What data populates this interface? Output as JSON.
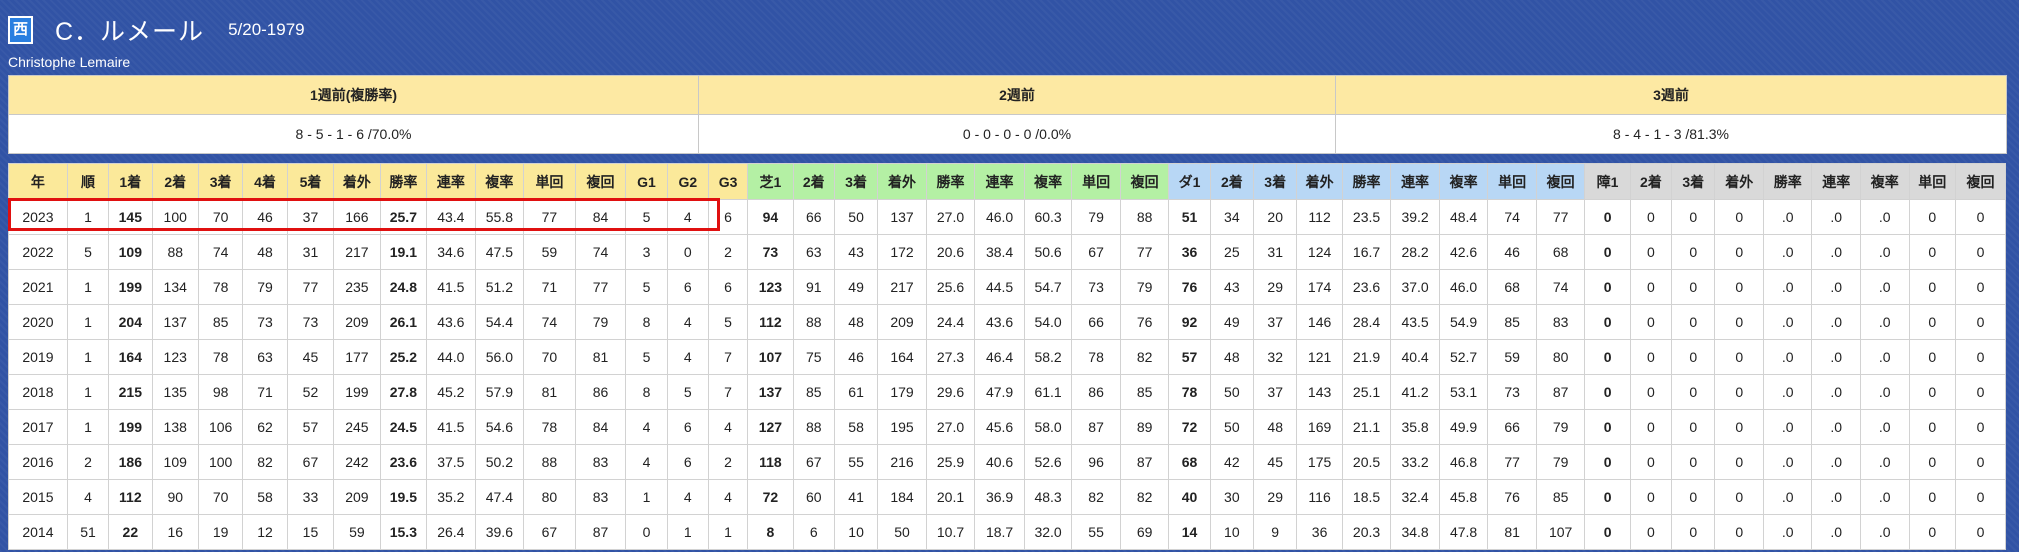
{
  "jockey": {
    "badge": "西",
    "name_jp": "C．ルメール",
    "dob": "5/20-1979",
    "name_en": "Christophe Lemaire"
  },
  "weeks": {
    "headers": [
      "1週前(複勝率)",
      "2週前",
      "3週前"
    ],
    "values": [
      "8 - 5 - 1 - 6 /70.0%",
      "0 - 0 - 0 - 0 /0.0%",
      "8 - 4 - 1 - 3 /81.3%"
    ]
  },
  "table": {
    "headers": [
      "年",
      "順",
      "1着",
      "2着",
      "3着",
      "4着",
      "5着",
      "着外",
      "勝率",
      "連率",
      "複率",
      "単回",
      "複回",
      "G1",
      "G2",
      "G3",
      "芝1",
      "2着",
      "3着",
      "着外",
      "勝率",
      "連率",
      "複率",
      "単回",
      "複回",
      "ダ1",
      "2着",
      "3着",
      "着外",
      "勝率",
      "連率",
      "複率",
      "単回",
      "複回",
      "障1",
      "2着",
      "3着",
      "着外",
      "勝率",
      "連率",
      "複率",
      "単回",
      "複回"
    ],
    "rows": [
      [
        "2023",
        "1",
        "145",
        "100",
        "70",
        "46",
        "37",
        "166",
        "25.7",
        "43.4",
        "55.8",
        "77",
        "84",
        "5",
        "4",
        "6",
        "94",
        "66",
        "50",
        "137",
        "27.0",
        "46.0",
        "60.3",
        "79",
        "88",
        "51",
        "34",
        "20",
        "112",
        "23.5",
        "39.2",
        "48.4",
        "74",
        "77",
        "0",
        "0",
        "0",
        "0",
        ".0",
        ".0",
        ".0",
        "0",
        "0"
      ],
      [
        "2022",
        "5",
        "109",
        "88",
        "74",
        "48",
        "31",
        "217",
        "19.1",
        "34.6",
        "47.5",
        "59",
        "74",
        "3",
        "0",
        "2",
        "73",
        "63",
        "43",
        "172",
        "20.6",
        "38.4",
        "50.6",
        "67",
        "77",
        "36",
        "25",
        "31",
        "124",
        "16.7",
        "28.2",
        "42.6",
        "46",
        "68",
        "0",
        "0",
        "0",
        "0",
        ".0",
        ".0",
        ".0",
        "0",
        "0"
      ],
      [
        "2021",
        "1",
        "199",
        "134",
        "78",
        "79",
        "77",
        "235",
        "24.8",
        "41.5",
        "51.2",
        "71",
        "77",
        "5",
        "6",
        "6",
        "123",
        "91",
        "49",
        "217",
        "25.6",
        "44.5",
        "54.7",
        "73",
        "79",
        "76",
        "43",
        "29",
        "174",
        "23.6",
        "37.0",
        "46.0",
        "68",
        "74",
        "0",
        "0",
        "0",
        "0",
        ".0",
        ".0",
        ".0",
        "0",
        "0"
      ],
      [
        "2020",
        "1",
        "204",
        "137",
        "85",
        "73",
        "73",
        "209",
        "26.1",
        "43.6",
        "54.4",
        "74",
        "79",
        "8",
        "4",
        "5",
        "112",
        "88",
        "48",
        "209",
        "24.4",
        "43.6",
        "54.0",
        "66",
        "76",
        "92",
        "49",
        "37",
        "146",
        "28.4",
        "43.5",
        "54.9",
        "85",
        "83",
        "0",
        "0",
        "0",
        "0",
        ".0",
        ".0",
        ".0",
        "0",
        "0"
      ],
      [
        "2019",
        "1",
        "164",
        "123",
        "78",
        "63",
        "45",
        "177",
        "25.2",
        "44.0",
        "56.0",
        "70",
        "81",
        "5",
        "4",
        "7",
        "107",
        "75",
        "46",
        "164",
        "27.3",
        "46.4",
        "58.2",
        "78",
        "82",
        "57",
        "48",
        "32",
        "121",
        "21.9",
        "40.4",
        "52.7",
        "59",
        "80",
        "0",
        "0",
        "0",
        "0",
        ".0",
        ".0",
        ".0",
        "0",
        "0"
      ],
      [
        "2018",
        "1",
        "215",
        "135",
        "98",
        "71",
        "52",
        "199",
        "27.8",
        "45.2",
        "57.9",
        "81",
        "86",
        "8",
        "5",
        "7",
        "137",
        "85",
        "61",
        "179",
        "29.6",
        "47.9",
        "61.1",
        "86",
        "85",
        "78",
        "50",
        "37",
        "143",
        "25.1",
        "41.2",
        "53.1",
        "73",
        "87",
        "0",
        "0",
        "0",
        "0",
        ".0",
        ".0",
        ".0",
        "0",
        "0"
      ],
      [
        "2017",
        "1",
        "199",
        "138",
        "106",
        "62",
        "57",
        "245",
        "24.5",
        "41.5",
        "54.6",
        "78",
        "84",
        "4",
        "6",
        "4",
        "127",
        "88",
        "58",
        "195",
        "27.0",
        "45.6",
        "58.0",
        "87",
        "89",
        "72",
        "50",
        "48",
        "169",
        "21.1",
        "35.8",
        "49.9",
        "66",
        "79",
        "0",
        "0",
        "0",
        "0",
        ".0",
        ".0",
        ".0",
        "0",
        "0"
      ],
      [
        "2016",
        "2",
        "186",
        "109",
        "100",
        "82",
        "67",
        "242",
        "23.6",
        "37.5",
        "50.2",
        "88",
        "83",
        "4",
        "6",
        "2",
        "118",
        "67",
        "55",
        "216",
        "25.9",
        "40.6",
        "52.6",
        "96",
        "87",
        "68",
        "42",
        "45",
        "175",
        "20.5",
        "33.2",
        "46.8",
        "77",
        "79",
        "0",
        "0",
        "0",
        "0",
        ".0",
        ".0",
        ".0",
        "0",
        "0"
      ],
      [
        "2015",
        "4",
        "112",
        "90",
        "70",
        "58",
        "33",
        "209",
        "19.5",
        "35.2",
        "47.4",
        "80",
        "83",
        "1",
        "4",
        "4",
        "72",
        "60",
        "41",
        "184",
        "20.1",
        "36.9",
        "48.3",
        "82",
        "82",
        "40",
        "30",
        "29",
        "116",
        "18.5",
        "32.4",
        "45.8",
        "76",
        "85",
        "0",
        "0",
        "0",
        "0",
        ".0",
        ".0",
        ".0",
        "0",
        "0"
      ],
      [
        "2014",
        "51",
        "22",
        "16",
        "19",
        "12",
        "15",
        "59",
        "15.3",
        "26.4",
        "39.6",
        "67",
        "87",
        "0",
        "1",
        "1",
        "8",
        "6",
        "10",
        "50",
        "10.7",
        "18.7",
        "32.0",
        "55",
        "69",
        "14",
        "10",
        "9",
        "36",
        "20.3",
        "34.8",
        "47.8",
        "81",
        "107",
        "0",
        "0",
        "0",
        "0",
        ".0",
        ".0",
        ".0",
        "0",
        "0"
      ]
    ]
  },
  "colors": {
    "background": "#3153a5",
    "general_header": "#fbe99a",
    "turf_header": "#b4f0a4",
    "dirt_header": "#b8d7f5",
    "jump_header": "#d9d9d9",
    "highlight_border": "#e01010"
  }
}
